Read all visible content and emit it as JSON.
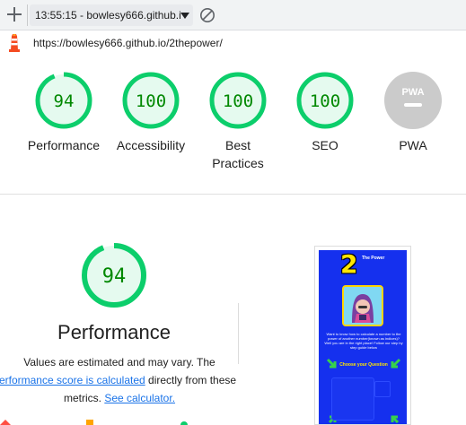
{
  "toolbar": {
    "report_select": "13:55:15 - bowlesy666.github.i"
  },
  "url": "https://bowlesy666.github.io/2thepower/",
  "gauges": [
    {
      "label": "Performance",
      "score": "94",
      "status": "pass"
    },
    {
      "label": "Accessibility",
      "score": "100",
      "status": "pass"
    },
    {
      "label_line1": "Best",
      "label_line2": "Practices",
      "score": "100",
      "status": "pass"
    },
    {
      "label": "SEO",
      "score": "100",
      "status": "pass"
    },
    {
      "label": "PWA",
      "score": "PWA",
      "status": "na"
    }
  ],
  "detail": {
    "score": "94",
    "title": "Performance",
    "desc_1": "Values are estimated and may vary. The",
    "desc_link_1": "erformance score is calculated",
    "desc_2": " directly from these",
    "desc_3": "metrics. ",
    "desc_link_2": "See calculator."
  },
  "thumbnail": {
    "number": "2",
    "title": "The Power",
    "paragraph": "Want to know how to calculate a number to the power of another number(known as indices)? Well you are in the right place! Follow our step by step guide below",
    "choose": "Choose your Question"
  },
  "colors": {
    "pass": "#0cce6b",
    "pass_bg": "#e5faef",
    "pass_text": "#008800",
    "na": "#cbcbcb",
    "link": "#1a73e8",
    "thumb_bg": "#1530ee"
  }
}
